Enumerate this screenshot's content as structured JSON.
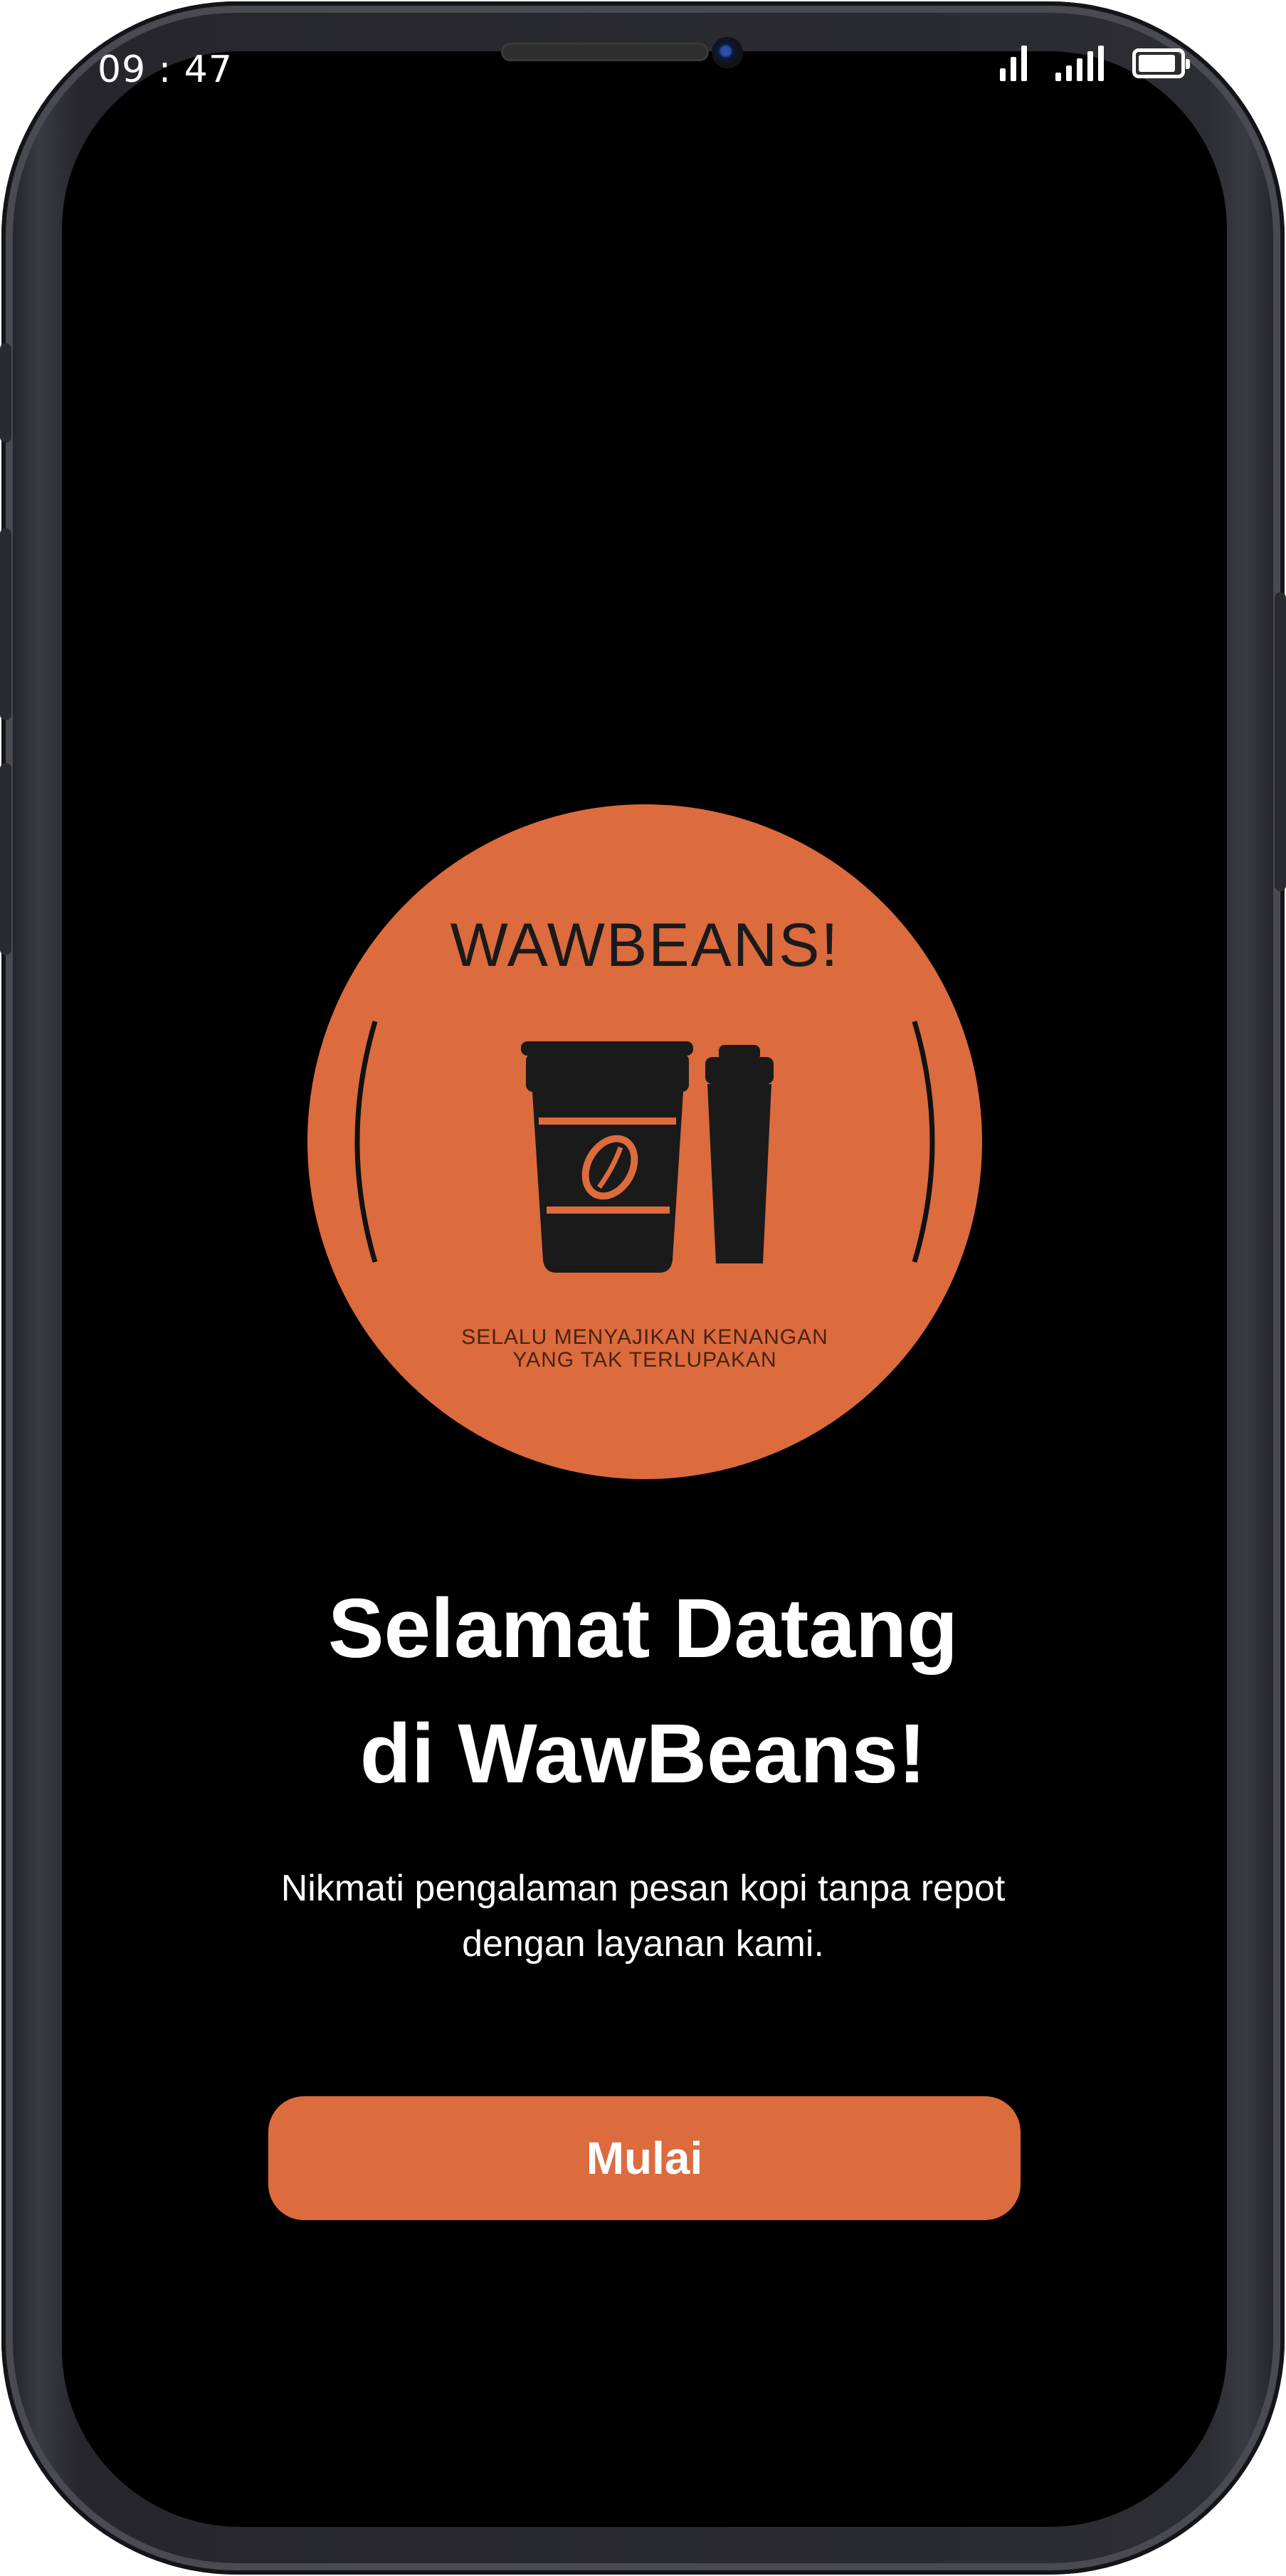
{
  "status_bar": {
    "time": "09 : 47",
    "battery_level": 0.8,
    "icons": [
      "signal-icon",
      "cellular-icon",
      "battery-icon"
    ]
  },
  "logo": {
    "brand": "WAWBEANS!",
    "tagline_line1": "SELALU MENYAJIKAN KENANGAN",
    "tagline_line2": "YANG TAK TERLUPAKAN",
    "icon": "coffee-cups-icon",
    "circle_color": "#DC6B3E"
  },
  "welcome": {
    "title_line1": "Selamat Datang",
    "title_line2": "di WawBeans!",
    "subtitle_line1": "Nikmati pengalaman pesan kopi tanpa repot",
    "subtitle_line2": "dengan layanan kami."
  },
  "actions": {
    "start_label": "Mulai"
  },
  "colors": {
    "accent": "#DC6B3E",
    "background": "#000000",
    "text": "#FFFFFF"
  }
}
